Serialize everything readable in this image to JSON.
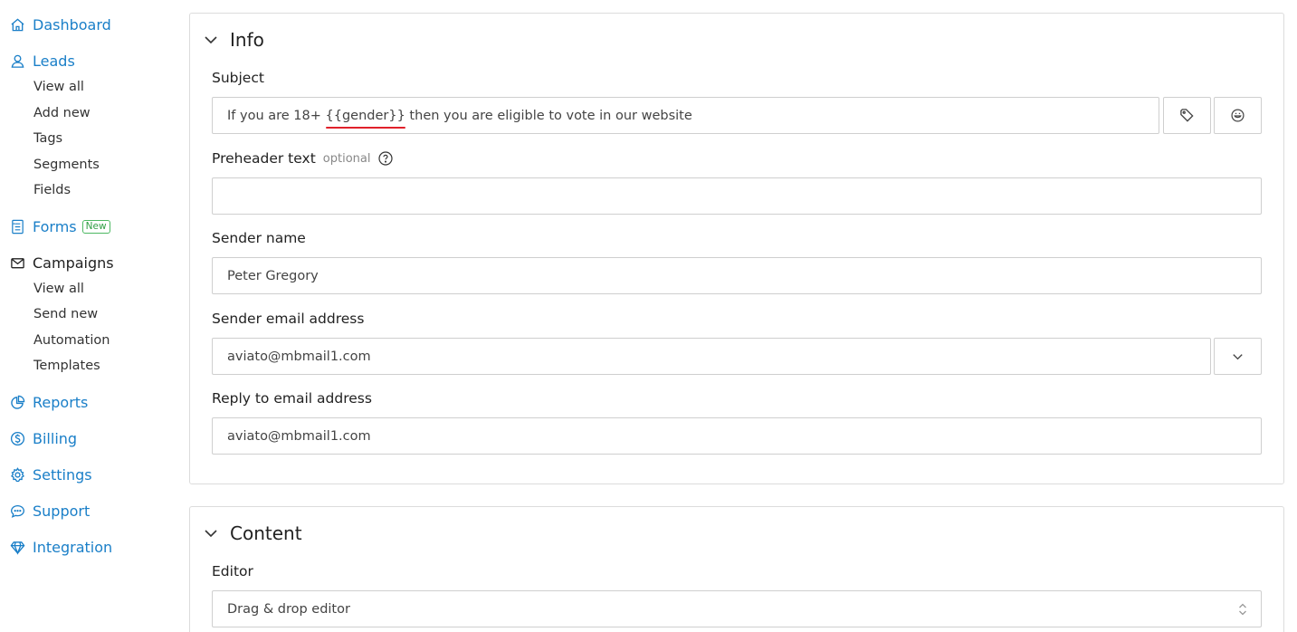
{
  "sidebar": {
    "dashboard": "Dashboard",
    "leads": "Leads",
    "leads_sub": [
      "View all",
      "Add new",
      "Tags",
      "Segments",
      "Fields"
    ],
    "forms": "Forms",
    "forms_badge": "New",
    "campaigns": "Campaigns",
    "campaigns_sub": [
      "View all",
      "Send new",
      "Automation",
      "Templates"
    ],
    "reports": "Reports",
    "billing": "Billing",
    "settings": "Settings",
    "support": "Support",
    "integration": "Integration"
  },
  "info": {
    "title": "Info",
    "subject_label": "Subject",
    "subject_pre": "If you are 18+ ",
    "subject_token": "{{gender}}",
    "subject_post": " then you are eligible to vote in our website",
    "preheader_label": "Preheader text",
    "preheader_optional": "optional",
    "preheader_value": "",
    "sender_name_label": "Sender name",
    "sender_name_value": "Peter Gregory",
    "sender_email_label": "Sender email address",
    "sender_email_value": "aviato@mbmail1.com",
    "reply_label": "Reply to email address",
    "reply_value": "aviato@mbmail1.com"
  },
  "content": {
    "title": "Content",
    "editor_label": "Editor",
    "editor_value": "Drag & drop editor"
  },
  "colors": {
    "link": "#1a7fc8",
    "badge": "#2e9e43",
    "underline": "#e0202a"
  }
}
